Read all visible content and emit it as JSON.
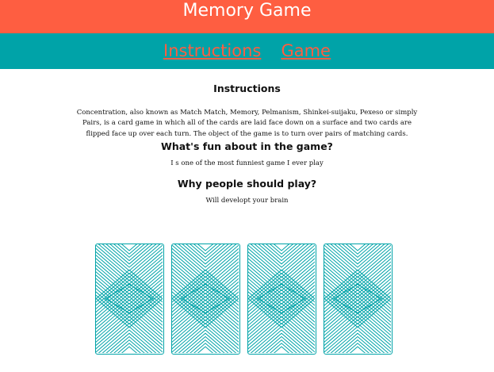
{
  "header": {
    "title": "Memory Game"
  },
  "nav": {
    "items": [
      {
        "label": "Instructions"
      },
      {
        "label": "Game"
      }
    ]
  },
  "instructions": {
    "title": "Instructions",
    "text": "Concentration, also known as Match Match, Memory, Pelmanism, Shinkei-suijaku, Pexeso or simply Pairs, is a card game in which all of the cards are laid face down on a surface and two cards are flipped face up over each turn. The object of the game is to turn over pairs of matching cards."
  },
  "fun": {
    "title": "What's fun about in the game?",
    "text": "I s one of the most funniest game I ever play"
  },
  "why": {
    "title": "Why people should play?",
    "text": "Will developt your brain"
  },
  "cards": {
    "count": 4,
    "color": "#00a3a8"
  },
  "colors": {
    "header": "#fe5e41",
    "nav": "#00a3a8",
    "link": "#fe5e41"
  }
}
